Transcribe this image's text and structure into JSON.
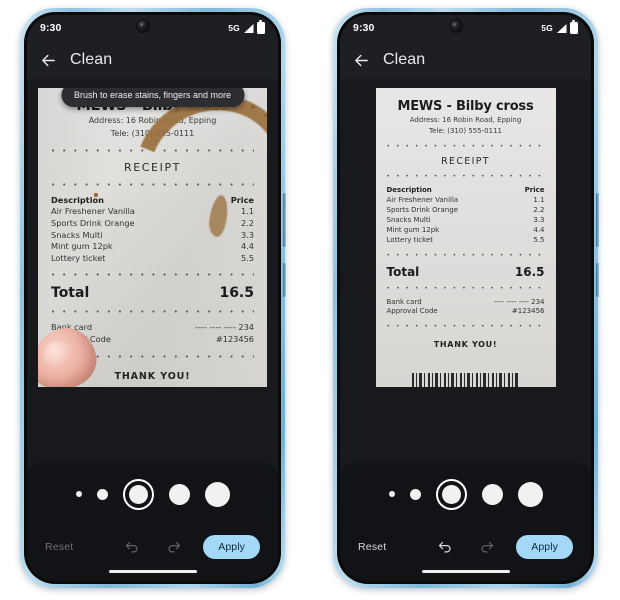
{
  "page": {
    "background": "#ffffff",
    "accent_blue": "#a4d8f7",
    "phone_frame_color": "#8fc2e0",
    "screen_bg": "#17191c",
    "panel_bg": "#121316"
  },
  "status_bar": {
    "time": "9:30",
    "network": "5G",
    "signal_icon": "signal-bars-icon",
    "battery_icon": "battery-full-icon",
    "camera_icon": "front-camera-punch-hole"
  },
  "app_bar": {
    "back_icon": "back-arrow-icon",
    "title": "Clean"
  },
  "tooltip": {
    "text": "Brush to erase stains, fingers and more"
  },
  "receipt": {
    "store": "MEWS - Bilby cross",
    "address": "Address: 16 Robin Road, Epping",
    "phone": "Tele: (310) 555-0111",
    "divider": "• • • • • • • • • • • • • • • • • • • • • • • • • •",
    "section_title": "RECEIPT",
    "columns": [
      "Description",
      "Price"
    ],
    "items": [
      {
        "description": "Air Freshener Vanilla",
        "price": "1.1"
      },
      {
        "description": "Sports Drink Orange",
        "price": "2.2"
      },
      {
        "description": "Snacks Multi",
        "price": "3.3"
      },
      {
        "description": "Mint gum 12pk",
        "price": "4.4"
      },
      {
        "description": "Lottery ticket",
        "price": "5.5"
      }
    ],
    "total_label": "Total",
    "total_value": "16.5",
    "payment": [
      {
        "label": "Bank card",
        "value": "---- ---- ---- 234"
      },
      {
        "label": "Approval Code",
        "value": "#123456"
      }
    ],
    "thanks": "THANK YOU!",
    "barcode_icon": "barcode"
  },
  "brush_sizes": {
    "label": "brush size selector",
    "dots": [
      {
        "size": 6,
        "selected": false
      },
      {
        "size": 11,
        "selected": false
      },
      {
        "size": 19,
        "selected": true
      },
      {
        "size": 21,
        "selected": false
      },
      {
        "size": 25,
        "selected": false
      }
    ],
    "selected_index": 2
  },
  "toolbar": {
    "reset_label": "Reset",
    "undo_icon": "undo-arrow-icon",
    "redo_icon": "redo-arrow-icon",
    "apply_label": "Apply"
  },
  "phones": [
    {
      "id": "before",
      "has_tooltip": true,
      "stains_visible": true,
      "reset_enabled": false,
      "undo_enabled": false,
      "redo_enabled": false,
      "stain_color": "#9b7140",
      "finger_color": "#eeb7a9"
    },
    {
      "id": "after",
      "has_tooltip": false,
      "stains_visible": false,
      "reset_enabled": true,
      "undo_enabled": true,
      "redo_enabled": false,
      "stain_color": "#9b7140",
      "finger_color": "#eeb7a9"
    }
  ],
  "gesture_bar": "home-gesture-bar"
}
